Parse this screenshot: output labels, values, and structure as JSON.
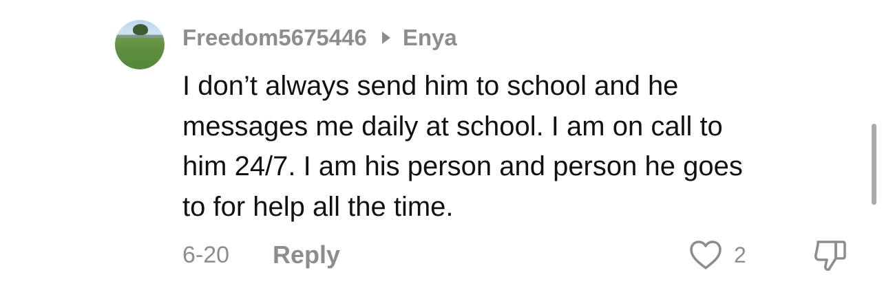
{
  "comment": {
    "author": "Freedom5675446",
    "reply_to": "Enya",
    "text": "I don’t always send him to school and he\nmessages me daily at school. I am on call to\nhim 24/7. I am his person and person he goes\nto for help all the time.",
    "date": "6-20",
    "reply_label": "Reply",
    "like_count": "2"
  },
  "icons": {
    "reply_arrow": "triangle-right-icon",
    "like": "heart-outline-icon",
    "dislike": "thumbs-down-outline-icon"
  },
  "colors": {
    "meta_gray": "#8d8d8d",
    "text": "#111111"
  }
}
